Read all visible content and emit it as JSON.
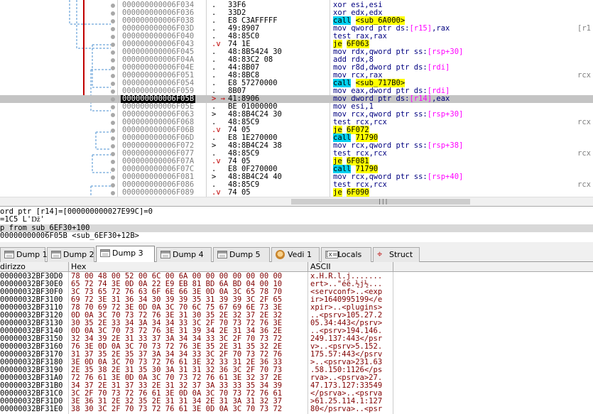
{
  "disasm": {
    "rows": [
      {
        "addr": "000000000006F034",
        "jmp": ".",
        "bytes": "33F6",
        "instr": [
          {
            "t": "xor esi,esi"
          }
        ],
        "cmt": ""
      },
      {
        "addr": "000000000006F036",
        "jmp": ".",
        "bytes": "33D2",
        "instr": [
          {
            "t": "xor edx,edx"
          }
        ],
        "cmt": ""
      },
      {
        "addr": "000000000006F038",
        "jmp": ".",
        "bytes": "E8 C3AFFFFF",
        "instr": [
          {
            "t": "call",
            "c": "call"
          },
          {
            "t": " "
          },
          {
            "t": "<sub_6A000>",
            "c": "sub"
          }
        ],
        "cmt": ""
      },
      {
        "addr": "000000000006F03D",
        "jmp": ".",
        "bytes": "49:8907",
        "instr": [
          {
            "t": "mov qword ptr ds:"
          },
          {
            "t": "[r15]",
            "c": "reg"
          },
          {
            "t": ",rax"
          }
        ],
        "cmt": "[r1"
      },
      {
        "addr": "000000000006F040",
        "jmp": ".",
        "bytes": "48:85C0",
        "instr": [
          {
            "t": "test rax,rax"
          }
        ],
        "cmt": ""
      },
      {
        "addr": "000000000006F043",
        "jmp": ".v",
        "bytes": "74 1E",
        "instr": [
          {
            "t": "je",
            "c": "je"
          },
          {
            "t": " "
          },
          {
            "t": "6F063",
            "c": "sub"
          }
        ],
        "cmt": ""
      },
      {
        "addr": "000000000006F045",
        "jmp": ".",
        "bytes": "48:8B5424 30",
        "instr": [
          {
            "t": "mov rdx,qword ptr ss:"
          },
          {
            "t": "[rsp+30]",
            "c": "reg"
          }
        ],
        "cmt": ""
      },
      {
        "addr": "000000000006F04A",
        "jmp": ".",
        "bytes": "48:83C2 08",
        "instr": [
          {
            "t": "add rdx,8"
          }
        ],
        "cmt": ""
      },
      {
        "addr": "000000000006F04E",
        "jmp": ".",
        "bytes": "44:8B07",
        "instr": [
          {
            "t": "mov r8d,dword ptr ds:"
          },
          {
            "t": "[rdi]",
            "c": "reg"
          }
        ],
        "cmt": ""
      },
      {
        "addr": "000000000006F051",
        "jmp": ".",
        "bytes": "48:8BC8",
        "instr": [
          {
            "t": "mov rcx,rax"
          }
        ],
        "cmt": "rcx"
      },
      {
        "addr": "000000000006F054",
        "jmp": ".",
        "bytes": "E8 57270000",
        "instr": [
          {
            "t": "call",
            "c": "call"
          },
          {
            "t": " "
          },
          {
            "t": "<sub_717B0>",
            "c": "sub"
          }
        ],
        "cmt": ""
      },
      {
        "addr": "000000000006F059",
        "jmp": ".",
        "bytes": "8B07",
        "instr": [
          {
            "t": "mov eax,dword ptr ds:"
          },
          {
            "t": "[rdi]",
            "c": "reg"
          }
        ],
        "cmt": ""
      },
      {
        "addr": "000000000006F05B",
        "jmp": "> →",
        "bytes": "41:8906",
        "instr": [
          {
            "t": "mov dword ptr ds:"
          },
          {
            "t": "[r14]",
            "c": "reg"
          },
          {
            "t": ",eax"
          }
        ],
        "cmt": "",
        "sel": true
      },
      {
        "addr": "000000000006F05E",
        "jmp": ".",
        "bytes": "BE 01000000",
        "instr": [
          {
            "t": "mov esi,1"
          }
        ],
        "cmt": ""
      },
      {
        "addr": "000000000006F063",
        "jmp": ">",
        "bytes": "48:8B4C24 30",
        "instr": [
          {
            "t": "mov rcx,qword ptr ss:"
          },
          {
            "t": "[rsp+30]",
            "c": "reg"
          }
        ],
        "cmt": ""
      },
      {
        "addr": "000000000006F068",
        "jmp": ".",
        "bytes": "48:85C9",
        "instr": [
          {
            "t": "test rcx,rcx"
          }
        ],
        "cmt": "rcx"
      },
      {
        "addr": "000000000006F06B",
        "jmp": ".v",
        "bytes": "74 05",
        "instr": [
          {
            "t": "je",
            "c": "je"
          },
          {
            "t": " "
          },
          {
            "t": "6F072",
            "c": "sub"
          }
        ],
        "cmt": ""
      },
      {
        "addr": "000000000006F06D",
        "jmp": ".",
        "bytes": "E8 1E270000",
        "instr": [
          {
            "t": "call",
            "c": "call"
          },
          {
            "t": " "
          },
          {
            "t": "71790",
            "c": "sub"
          }
        ],
        "cmt": ""
      },
      {
        "addr": "000000000006F072",
        "jmp": ">",
        "bytes": "48:8B4C24 38",
        "instr": [
          {
            "t": "mov rcx,qword ptr ss:"
          },
          {
            "t": "[rsp+38]",
            "c": "reg"
          }
        ],
        "cmt": ""
      },
      {
        "addr": "000000000006F077",
        "jmp": ".",
        "bytes": "48:85C9",
        "instr": [
          {
            "t": "test rcx,rcx"
          }
        ],
        "cmt": "rcx"
      },
      {
        "addr": "000000000006F07A",
        "jmp": ".v",
        "bytes": "74 05",
        "instr": [
          {
            "t": "je",
            "c": "je"
          },
          {
            "t": " "
          },
          {
            "t": "6F081",
            "c": "sub"
          }
        ],
        "cmt": ""
      },
      {
        "addr": "000000000006F07C",
        "jmp": ".",
        "bytes": "E8 0F270000",
        "instr": [
          {
            "t": "call",
            "c": "call"
          },
          {
            "t": " "
          },
          {
            "t": "71790",
            "c": "sub"
          }
        ],
        "cmt": ""
      },
      {
        "addr": "000000000006F081",
        "jmp": ">",
        "bytes": "48:8B4C24 40",
        "instr": [
          {
            "t": "mov rcx,qword ptr ss:"
          },
          {
            "t": "[rsp+40]",
            "c": "reg"
          }
        ],
        "cmt": ""
      },
      {
        "addr": "000000000006F086",
        "jmp": ".",
        "bytes": "48:85C9",
        "instr": [
          {
            "t": "test rcx,rcx"
          }
        ],
        "cmt": "rcx"
      },
      {
        "addr": "000000000006F089",
        "jmp": ".v",
        "bytes": "74 05",
        "instr": [
          {
            "t": "je",
            "c": "je"
          },
          {
            "t": " "
          },
          {
            "t": "6F090",
            "c": "sub"
          }
        ],
        "cmt": ""
      }
    ]
  },
  "scroll_grip": "|||",
  "info": {
    "line1": "ord ptr [r14]=[000000000027E99C]=0",
    "line2": "=1C5 L'ǅ'",
    "line3": "p from sub_6EF30+100",
    "line4": "00000000006F05B <sub_6EF30+12B>"
  },
  "tabs": [
    {
      "label": "Dump 1",
      "icon": "dump-icon"
    },
    {
      "label": "Dump 2",
      "icon": "dump-icon"
    },
    {
      "label": "Dump 3",
      "icon": "dump-icon",
      "active": true
    },
    {
      "label": "Dump 4",
      "icon": "dump-icon"
    },
    {
      "label": "Dump 5",
      "icon": "dump-icon"
    },
    {
      "label": "Vedi 1",
      "icon": "watch-icon"
    },
    {
      "label": "Locals",
      "icon": "locals-icon",
      "glyph": "[x=]"
    },
    {
      "label": "Struct",
      "icon": "struct-icon",
      "glyph": "⌖"
    }
  ],
  "hex": {
    "headers": {
      "addr": "dirizzo",
      "hex": "Hex",
      "ascii": "ASCII"
    },
    "rows": [
      {
        "addr": "00000032BF30D0",
        "hex": "78 00 48 00 52 00 6C 00 6A 00 00 00 00 00 00 00",
        "ascii": "x.H.R.l.j......."
      },
      {
        "addr": "00000032BF30E0",
        "hex": "65 72 74 3E 0D 0A 22 E9 EB 81 BD 6A BD 04 00 10",
        "ascii": "ert>..\"éë.½j½..."
      },
      {
        "addr": "00000032BF30F0",
        "hex": "3C 73 65 72 76 63 6F 6E 66 3E 0D 0A 3C 65 78 70",
        "ascii": "<servconf>..<exp"
      },
      {
        "addr": "00000032BF3100",
        "hex": "69 72 3E 31 36 34 30 39 39 35 31 39 39 3C 2F 65",
        "ascii": "ir>1640995199</e"
      },
      {
        "addr": "00000032BF3110",
        "hex": "78 70 69 72 3E 0D 0A 3C 70 6C 75 67 69 6E 73 3E",
        "ascii": "xpir>..<plugins>"
      },
      {
        "addr": "00000032BF3120",
        "hex": "0D 0A 3C 70 73 72 76 3E 31 30 35 2E 32 37 2E 32",
        "ascii": "..<psrv>105.27.2"
      },
      {
        "addr": "00000032BF3130",
        "hex": "30 35 2E 33 34 3A 34 34 33 3C 2F 70 73 72 76 3E",
        "ascii": "05.34:443</psrv>"
      },
      {
        "addr": "00000032BF3140",
        "hex": "0D 0A 3C 70 73 72 76 3E 31 39 34 2E 31 34 36 2E",
        "ascii": "..<psrv>194.146."
      },
      {
        "addr": "00000032BF3150",
        "hex": "32 34 39 2E 31 33 37 3A 34 34 33 3C 2F 70 73 72",
        "ascii": "249.137:443</psr"
      },
      {
        "addr": "00000032BF3160",
        "hex": "76 3E 0D 0A 3C 70 73 72 76 3E 35 2E 31 35 32 2E",
        "ascii": "v>..<psrv>5.152."
      },
      {
        "addr": "00000032BF3170",
        "hex": "31 37 35 2E 35 37 3A 34 34 33 3C 2F 70 73 72 76",
        "ascii": "175.57:443</psrv"
      },
      {
        "addr": "00000032BF3180",
        "hex": "3E 0D 0A 3C 70 73 72 76 61 3E 32 33 31 2E 36 33",
        "ascii": ">..<psrva>231.63"
      },
      {
        "addr": "00000032BF3190",
        "hex": "2E 35 38 2E 31 35 30 3A 31 31 32 36 3C 2F 70 73",
        "ascii": ".58.150:1126</ps"
      },
      {
        "addr": "00000032BF31A0",
        "hex": "72 76 61 3E 0D 0A 3C 70 73 72 76 61 3E 32 37 2E",
        "ascii": "rva>..<psrva>27."
      },
      {
        "addr": "00000032BF31B0",
        "hex": "34 37 2E 31 37 33 2E 31 32 37 3A 33 33 35 34 39",
        "ascii": "47.173.127:33549"
      },
      {
        "addr": "00000032BF31C0",
        "hex": "3C 2F 70 73 72 76 61 3E 0D 0A 3C 70 73 72 76 61",
        "ascii": "</psrva>..<psrva"
      },
      {
        "addr": "00000032BF31D0",
        "hex": "3E 36 31 2E 32 35 2E 31 31 34 2E 31 3A 31 32 37",
        "ascii": ">61.25.114.1:127"
      },
      {
        "addr": "00000032BF31E0",
        "hex": "38 30 3C 2F 70 73 72 76 61 3E 0D 0A 3C 70 73 72",
        "ascii": "80</psrva>..<psr"
      }
    ]
  },
  "colors": {
    "selected_row": "#c4c4c4",
    "call_bg": "#00d0f0",
    "je_bg": "#ffff00",
    "jump_red": "#c00000",
    "arrow_blue": "#1030c0",
    "hex_text": "#800000"
  }
}
